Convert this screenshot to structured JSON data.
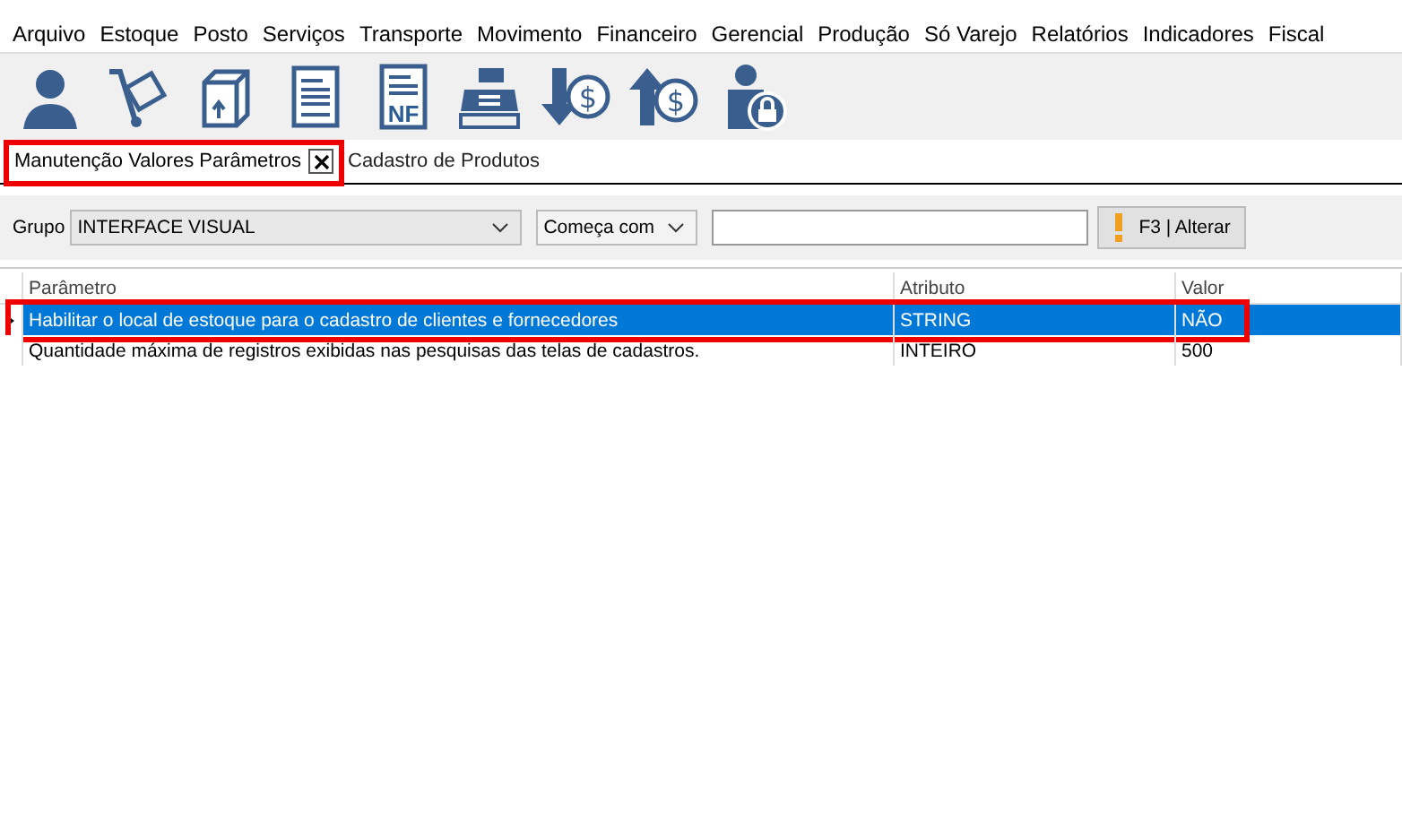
{
  "menu": [
    "Arquivo",
    "Estoque",
    "Posto",
    "Serviços",
    "Transporte",
    "Movimento",
    "Financeiro",
    "Gerencial",
    "Produção",
    "Só Varejo",
    "Relatórios",
    "Indicadores",
    "Fiscal"
  ],
  "toolbar": [
    {
      "kind": "person"
    },
    {
      "kind": "cart"
    },
    {
      "kind": "box"
    },
    {
      "kind": "doc"
    },
    {
      "kind": "nf",
      "label": "NF"
    },
    {
      "kind": "register"
    },
    {
      "kind": "money-down",
      "label": "$"
    },
    {
      "kind": "money-up",
      "label": "$"
    },
    {
      "kind": "lock-user"
    }
  ],
  "tabs": [
    {
      "label": "Manutenção Valores Parâmetros",
      "selected": true,
      "closable": true,
      "highlighted": true
    },
    {
      "label": "Cadastro de Produtos",
      "selected": false,
      "closable": false,
      "highlighted": false
    }
  ],
  "filter": {
    "group_label": "Grupo",
    "group_value": "INTERFACE VISUAL",
    "mode_value": "Começa com",
    "button": "F3 | Alterar"
  },
  "table": {
    "columns": [
      "Parâmetro",
      "Atributo",
      "Valor"
    ],
    "rows": [
      {
        "cells": [
          "Habilitar o local de estoque para o cadastro de clientes e fornecedores",
          "STRING",
          "NÃO"
        ],
        "selected": true,
        "highlighted": true
      },
      {
        "cells": [
          "Quantidade máxima de registros exibidas nas pesquisas das telas de cadastros.",
          "INTEIRO",
          "500"
        ],
        "selected": false,
        "highlighted": false
      }
    ]
  }
}
